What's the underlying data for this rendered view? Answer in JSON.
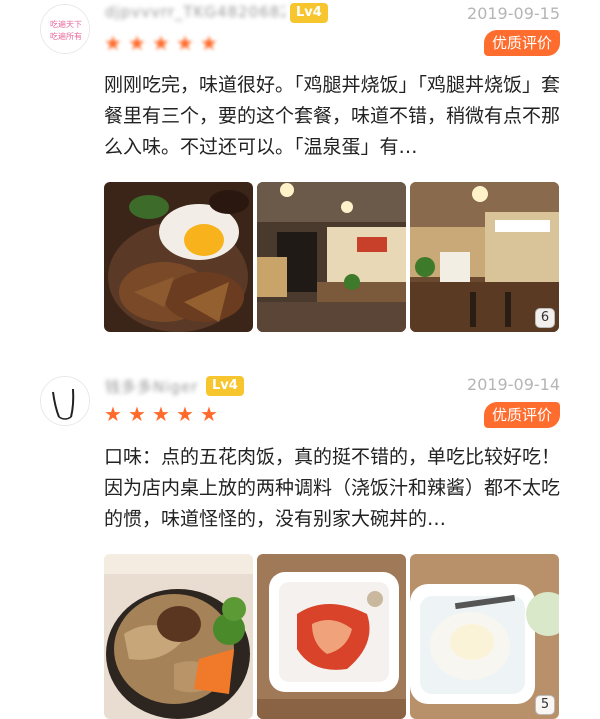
{
  "reviews": [
    {
      "username": "djpvvvrr_TKG4820682",
      "level": "Lv4",
      "date": "2019-09-15",
      "rating": 5,
      "badge": "优质评价",
      "text": "刚刚吃完，味道很好。「鸡腿丼烧饭」「鸡腿丼烧饭」套餐里有三个，要的这个套餐，味道不错，稍微有点不那么入味。不过还可以。「温泉蛋」有…",
      "photo_count": "6",
      "avatar_text": [
        "吃遍天下",
        "吃遍所有"
      ],
      "photos": [
        "chicken-rice-bowl-photo",
        "restaurant-interior-photo",
        "restaurant-counter-photo"
      ]
    },
    {
      "username": "钱多多Niger",
      "level": "Lv4",
      "date": "2019-09-14",
      "rating": 5,
      "badge": "优质评价",
      "text": "口味：点的五花肉饭，真的挺不错的，单吃比较好吃！因为店内桌上放的两种调料（浇饭汁和辣酱）都不太吃的惯，味道怪怪的，没有别家大碗丼的…",
      "photo_count": "5",
      "photos": [
        "pork-rice-bowl-photo",
        "kimchi-side-dish-photo",
        "onsen-egg-photo"
      ]
    }
  ],
  "colors": {
    "accent": "#ff6d2e",
    "level_badge": "#f7c62f",
    "date_gray": "#b5b5b5"
  }
}
